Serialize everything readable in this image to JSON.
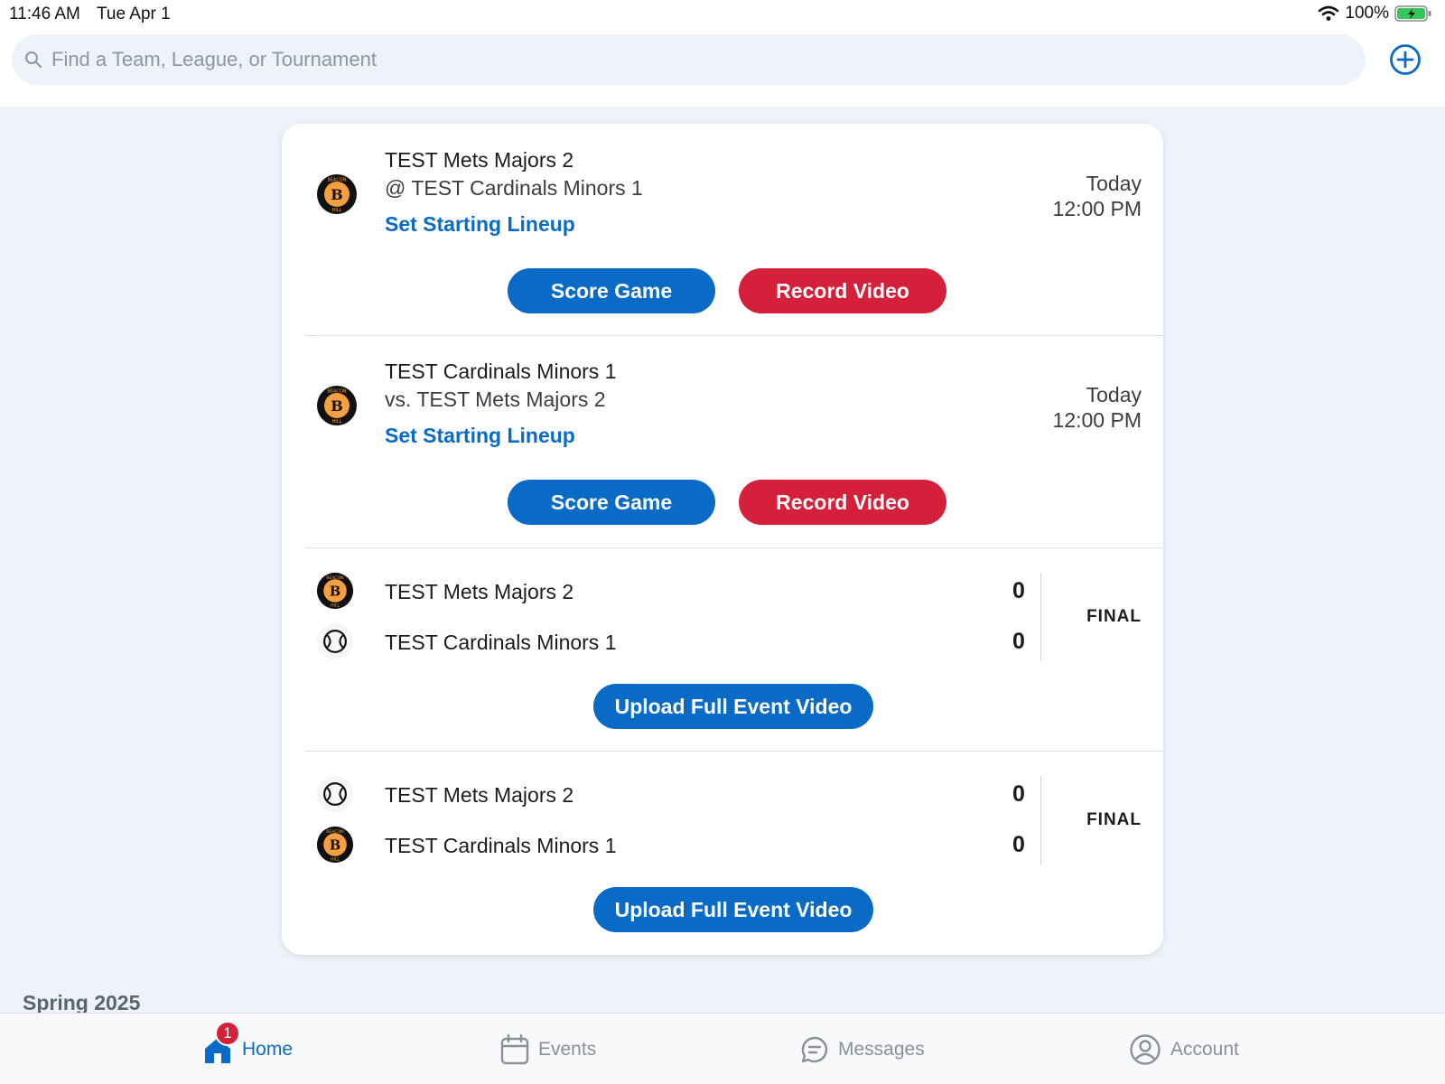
{
  "status_bar": {
    "time": "11:46 AM",
    "date": "Tue Apr 1",
    "battery": "100%"
  },
  "search": {
    "placeholder": "Find a Team, League, or Tournament"
  },
  "colors": {
    "accent": "#0a6bc7",
    "record": "#d4203b",
    "background": "#eef2f9"
  },
  "events": [
    {
      "type": "upcoming",
      "team": "TEST Mets Majors 2",
      "opponent": "@ TEST Cardinals Minors 1",
      "lineup_label": "Set Starting Lineup",
      "day": "Today",
      "time": "12:00 PM",
      "score_label": "Score Game",
      "record_label": "Record Video"
    },
    {
      "type": "upcoming",
      "team": "TEST Cardinals Minors 1",
      "opponent": "vs. TEST Mets Majors 2",
      "lineup_label": "Set Starting Lineup",
      "day": "Today",
      "time": "12:00 PM",
      "score_label": "Score Game",
      "record_label": "Record Video"
    },
    {
      "type": "final",
      "rows": [
        {
          "team": "TEST Mets Majors 2",
          "score": "0",
          "logo": "beacon-hill-logo"
        },
        {
          "team": "TEST Cardinals Minors 1",
          "score": "0",
          "logo": "baseball-icon"
        }
      ],
      "status": "FINAL",
      "upload_label": "Upload Full Event Video"
    },
    {
      "type": "final",
      "rows": [
        {
          "team": "TEST Mets Majors 2",
          "score": "0",
          "logo": "baseball-icon"
        },
        {
          "team": "TEST Cardinals Minors 1",
          "score": "0",
          "logo": "beacon-hill-logo"
        }
      ],
      "status": "FINAL",
      "upload_label": "Upload Full Event Video"
    }
  ],
  "season": {
    "label": "Spring 2025"
  },
  "tabs": [
    {
      "label": "Home",
      "icon": "home-icon",
      "badge": "1",
      "active": true
    },
    {
      "label": "Events",
      "icon": "calendar-icon"
    },
    {
      "label": "Messages",
      "icon": "chat-icon"
    },
    {
      "label": "Account",
      "icon": "account-icon"
    }
  ]
}
